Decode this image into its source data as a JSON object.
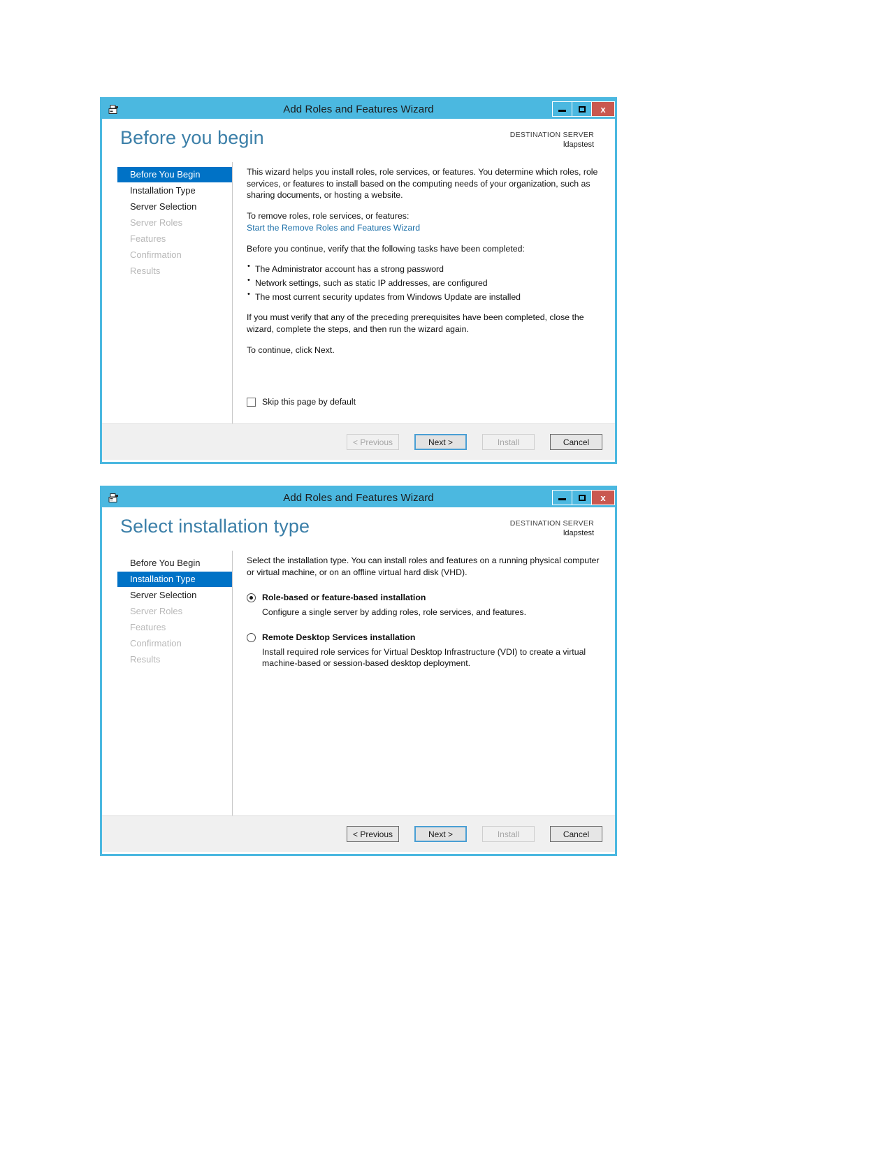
{
  "window": {
    "title": "Add Roles and Features Wizard",
    "icon": "server-wizard-icon",
    "minimize_label": "Minimize",
    "maximize_label": "Maximize",
    "close_label": "x",
    "accent_color": "#4bb8e0",
    "close_color": "#c9584f",
    "nav_active_color": "#0072c6"
  },
  "destination": {
    "label": "DESTINATION SERVER",
    "value": "ldapstest"
  },
  "nav": {
    "items": [
      {
        "label": "Before You Begin",
        "state": "active"
      },
      {
        "label": "Installation Type",
        "state": "enabled"
      },
      {
        "label": "Server Selection",
        "state": "enabled"
      },
      {
        "label": "Server Roles",
        "state": "disabled"
      },
      {
        "label": "Features",
        "state": "disabled"
      },
      {
        "label": "Confirmation",
        "state": "disabled"
      },
      {
        "label": "Results",
        "state": "disabled"
      }
    ]
  },
  "nav2": {
    "items": [
      {
        "label": "Before You Begin",
        "state": "enabled"
      },
      {
        "label": "Installation Type",
        "state": "active"
      },
      {
        "label": "Server Selection",
        "state": "enabled"
      },
      {
        "label": "Server Roles",
        "state": "disabled"
      },
      {
        "label": "Features",
        "state": "disabled"
      },
      {
        "label": "Confirmation",
        "state": "disabled"
      },
      {
        "label": "Results",
        "state": "disabled"
      }
    ]
  },
  "page1": {
    "title": "Before you begin",
    "intro": "This wizard helps you install roles, role services, or features. You determine which roles, role services, or features to install based on the computing needs of your organization, such as sharing documents, or hosting a website.",
    "remove_prompt": "To remove roles, role services, or features:",
    "remove_link": "Start the Remove Roles and Features Wizard",
    "verify_prompt": "Before you continue, verify that the following tasks have been completed:",
    "tasks": [
      "The Administrator account has a strong password",
      "Network settings, such as static IP addresses, are configured",
      "The most current security updates from Windows Update are installed"
    ],
    "prereq_note": "If you must verify that any of the preceding prerequisites have been completed, close the wizard, complete the steps, and then run the wizard again.",
    "continue_note": "To continue, click Next.",
    "skip_checkbox": {
      "label": "Skip this page by default",
      "checked": false
    }
  },
  "page2": {
    "title": "Select installation type",
    "intro": "Select the installation type. You can install roles and features on a running physical computer or virtual machine, or on an offline virtual hard disk (VHD).",
    "options": [
      {
        "title": "Role-based or feature-based installation",
        "description": "Configure a single server by adding roles, role services, and features.",
        "selected": true
      },
      {
        "title": "Remote Desktop Services installation",
        "description": "Install required role services for Virtual Desktop Infrastructure (VDI) to create a virtual machine-based or session-based desktop deployment.",
        "selected": false
      }
    ]
  },
  "footer": {
    "previous": "< Previous",
    "next": "Next >",
    "install": "Install",
    "cancel": "Cancel"
  },
  "footer1_states": {
    "previous": "disabled",
    "next": "focused",
    "install": "disabled",
    "cancel": "enabled"
  },
  "footer2_states": {
    "previous": "enabled",
    "next": "focused",
    "install": "disabled",
    "cancel": "enabled"
  }
}
